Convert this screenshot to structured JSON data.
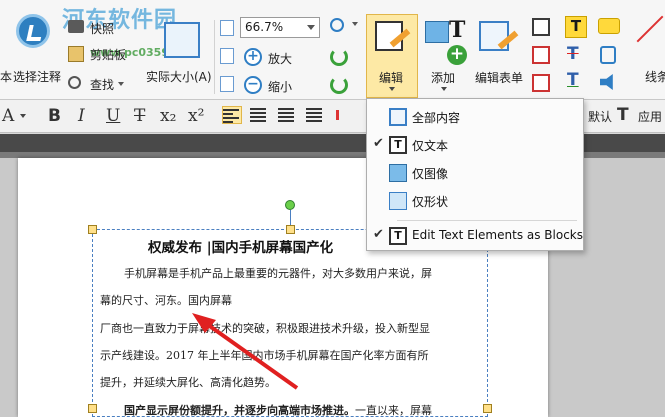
{
  "watermark": {
    "site_name": "河东软件园",
    "url": "www.pc0359.cn"
  },
  "ribbon": {
    "partial_left_label": "本",
    "select_annotation": "选择注释",
    "snapshot": "快照",
    "clipboard": "剪贴板",
    "find": "查找",
    "actual_size": "实际大小(A)",
    "zoom_value": "66.7%",
    "zoom_in": "放大",
    "zoom_out": "缩小",
    "edit": "编辑",
    "add": "添加",
    "edit_form": "编辑表单",
    "partial_right_label": "线条",
    "default_label": "默认",
    "apply_label": "应用"
  },
  "format_bar": {
    "bold": "B",
    "italic": "I",
    "underline": "U",
    "strike": "T",
    "subscript": "x₂",
    "superscript": "x²"
  },
  "edit_menu": {
    "items": [
      {
        "label": "全部内容",
        "checked": false,
        "icon": "all-content-icon"
      },
      {
        "label": "仅文本",
        "checked": true,
        "icon": "text-only-icon"
      },
      {
        "label": "仅图像",
        "checked": false,
        "icon": "image-only-icon"
      },
      {
        "label": "仅形状",
        "checked": false,
        "icon": "shape-only-icon"
      }
    ],
    "blocks_item": {
      "label": "Edit Text Elements as Blocks",
      "checked": true,
      "icon": "text-blocks-icon"
    }
  },
  "document": {
    "title": "权威发布 |国内手机屏幕国产化",
    "lines": [
      "手机屏幕是手机产品上最重要的元器件，对大多数用户来说，屏",
      "幕的尺寸、河东。国内屏幕",
      "厂商也一直致力于屏幕技术的突破，积极跟进技术升级，投入新型显",
      "示产线建设。2017 年上半年国内市场手机屏幕在国产化率方面有所",
      "提升，并延续大屏化、高清化趋势。"
    ],
    "bold_lead": "国产显示屏份额提升，并逐步向高端市场推进。",
    "bold_tail": "一直以来，屏幕"
  },
  "colors": {
    "accent_active": "#fde9a5",
    "selection_border": "#4a7fc1",
    "arrow": "#e02020"
  }
}
